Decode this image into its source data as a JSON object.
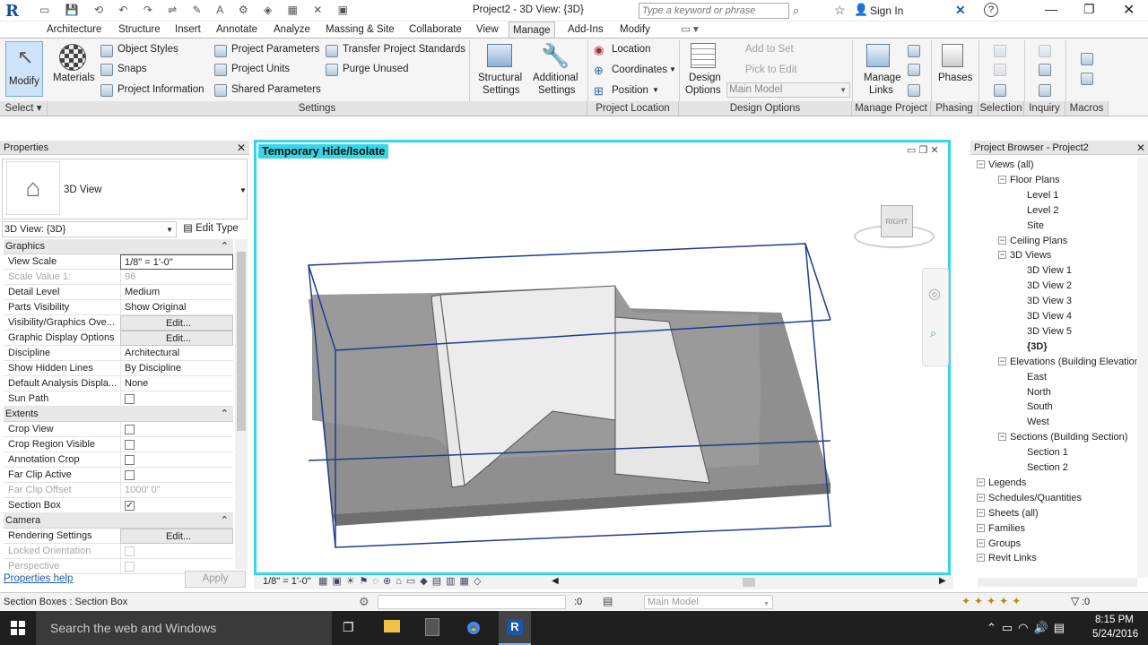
{
  "app": {
    "window_title": "Project2 - 3D View: {3D}",
    "search_placeholder": "Type a keyword or phrase",
    "sign_in": "Sign In"
  },
  "ribbon_tabs": [
    "Architecture",
    "Structure",
    "Insert",
    "Annotate",
    "Analyze",
    "Massing & Site",
    "Collaborate",
    "View",
    "Manage",
    "Add-Ins",
    "Modify"
  ],
  "active_tab": "Manage",
  "ribbon": {
    "modify": "Modify",
    "materials": "Materials",
    "object_styles": "Object  Styles",
    "snaps": "Snaps",
    "project_information": "Project  Information",
    "project_parameters": "Project  Parameters",
    "project_units": "Project  Units",
    "shared_parameters": "Shared  Parameters",
    "transfer_standards": "Transfer  Project Standards",
    "purge_unused": "Purge  Unused",
    "structural_settings_1": "Structural",
    "structural_settings_2": "Settings",
    "additional_settings_1": "Additional",
    "additional_settings_2": "Settings",
    "location": "Location",
    "coordinates": "Coordinates",
    "position": "Position",
    "design_options_1": "Design",
    "design_options_2": "Options",
    "add_to_set": "Add to Set",
    "pick_to_edit": "Pick to Edit",
    "main_model": "Main Model",
    "manage_links_1": "Manage",
    "manage_links_2": "Links",
    "phases": "Phases"
  },
  "panels": {
    "select": "Select",
    "settings": "Settings",
    "project_location": "Project Location",
    "design_options": "Design Options",
    "manage_project": "Manage Project",
    "phasing": "Phasing",
    "selection": "Selection",
    "inquiry": "Inquiry",
    "macros": "Macros"
  },
  "properties": {
    "title": "Properties",
    "type_name": "3D View",
    "selector": "3D View: {3D}",
    "edit_type": "Edit Type",
    "help": "Properties help",
    "apply": "Apply",
    "groups": {
      "graphics": "Graphics",
      "extents": "Extents",
      "camera": "Camera"
    },
    "rows": [
      {
        "k": "View Scale",
        "v": "1/8\" = 1'-0\""
      },
      {
        "k": "Scale Value    1:",
        "v": "96"
      },
      {
        "k": "Detail Level",
        "v": "Medium"
      },
      {
        "k": "Parts Visibility",
        "v": "Show Original"
      },
      {
        "k": "Visibility/Graphics Ove...",
        "v": "Edit..."
      },
      {
        "k": "Graphic Display Options",
        "v": "Edit..."
      },
      {
        "k": "Discipline",
        "v": "Architectural"
      },
      {
        "k": "Show Hidden Lines",
        "v": "By Discipline"
      },
      {
        "k": "Default Analysis Displa...",
        "v": "None"
      },
      {
        "k": "Sun Path",
        "v": ""
      },
      {
        "k": "Crop View",
        "v": ""
      },
      {
        "k": "Crop Region Visible",
        "v": ""
      },
      {
        "k": "Annotation Crop",
        "v": ""
      },
      {
        "k": "Far Clip Active",
        "v": ""
      },
      {
        "k": "Far Clip Offset",
        "v": "1000'  0\""
      },
      {
        "k": "Section Box",
        "v": "✓"
      },
      {
        "k": "Rendering Settings",
        "v": "Edit..."
      },
      {
        "k": "Locked Orientation",
        "v": ""
      },
      {
        "k": "Perspective",
        "v": ""
      }
    ]
  },
  "viewport": {
    "banner": "Temporary Hide/Isolate",
    "viewcube_label": "RIGHT",
    "scale": "1/8\" = 1'-0\""
  },
  "browser": {
    "title": "Project Browser - Project2",
    "nodes": [
      {
        "t": "Views (all)",
        "d": 1
      },
      {
        "t": "Floor Plans",
        "d": 2
      },
      {
        "t": "Level 1",
        "d": 3
      },
      {
        "t": "Level 2",
        "d": 3
      },
      {
        "t": "Site",
        "d": 3
      },
      {
        "t": "Ceiling Plans",
        "d": 2
      },
      {
        "t": "3D Views",
        "d": 2
      },
      {
        "t": "3D View 1",
        "d": 3
      },
      {
        "t": "3D View 2",
        "d": 3
      },
      {
        "t": "3D View 3",
        "d": 3
      },
      {
        "t": "3D View 4",
        "d": 3
      },
      {
        "t": "3D View 5",
        "d": 3
      },
      {
        "t": "{3D}",
        "d": 3
      },
      {
        "t": "Elevations (Building Elevation)",
        "d": 2
      },
      {
        "t": "East",
        "d": 3
      },
      {
        "t": "North",
        "d": 3
      },
      {
        "t": "South",
        "d": 3
      },
      {
        "t": "West",
        "d": 3
      },
      {
        "t": "Sections (Building Section)",
        "d": 2
      },
      {
        "t": "Section 1",
        "d": 3
      },
      {
        "t": "Section 2",
        "d": 3
      },
      {
        "t": "Legends",
        "d": 1
      },
      {
        "t": "Schedules/Quantities",
        "d": 1
      },
      {
        "t": "Sheets (all)",
        "d": 1
      },
      {
        "t": "Families",
        "d": 1
      },
      {
        "t": "Groups",
        "d": 1
      },
      {
        "t": "Revit Links",
        "d": 1
      }
    ]
  },
  "status": {
    "text": "Section Boxes : Section Box",
    "zero": ":0",
    "model": "Main Model",
    "filter": ":0"
  },
  "taskbar": {
    "search": "Search the web and Windows",
    "time": "8:15 PM",
    "date": "5/24/2016"
  }
}
